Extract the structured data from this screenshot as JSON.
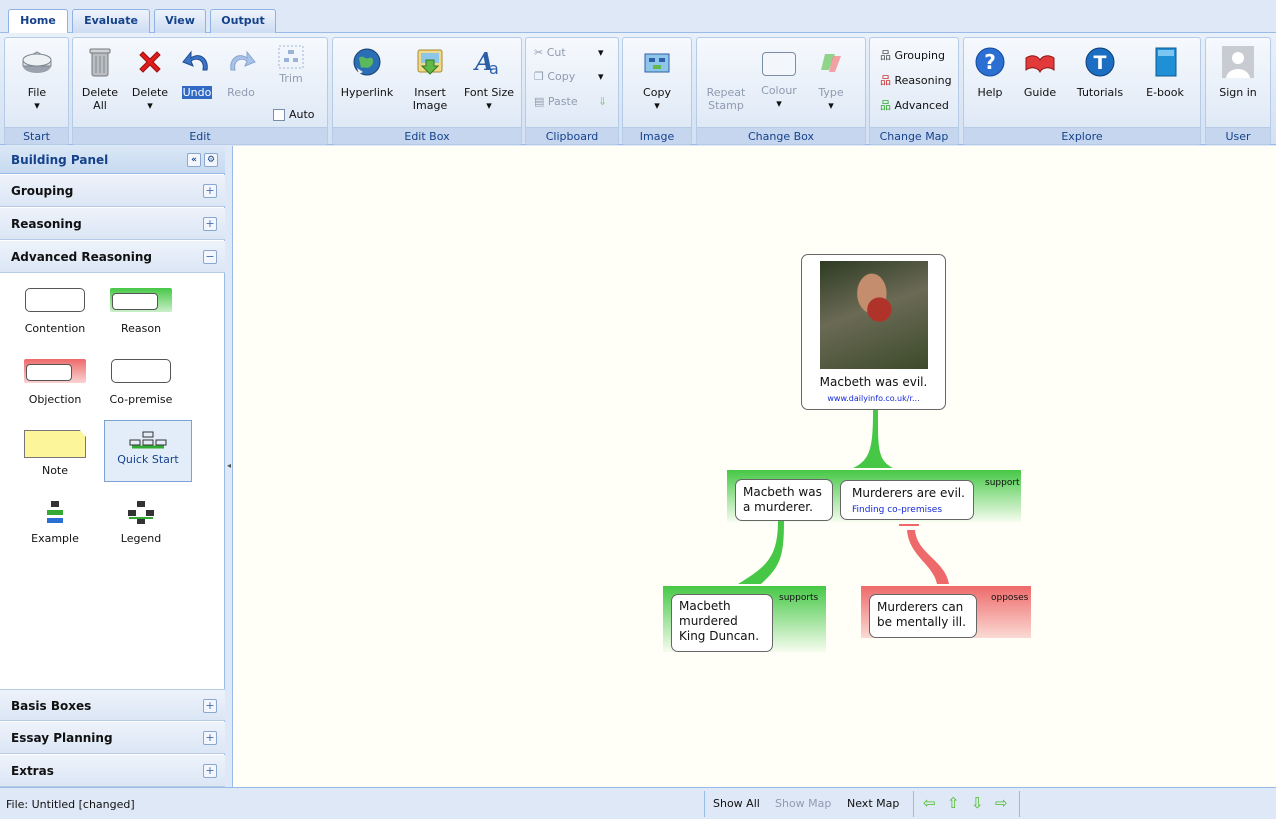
{
  "tabs": [
    "Home",
    "Evaluate",
    "View",
    "Output"
  ],
  "ribbon": {
    "start": {
      "title": "Start",
      "file": "File"
    },
    "edit": {
      "title": "Edit",
      "delete_all_1": "Delete",
      "delete_all_2": "All",
      "delete": "Delete",
      "undo": "Undo",
      "redo": "Redo",
      "trim": "Trim",
      "auto": "Auto"
    },
    "editbox": {
      "title": "Edit Box",
      "hyperlink": "Hyperlink",
      "insert_1": "Insert",
      "insert_2": "Image",
      "font_size": "Font Size"
    },
    "clipboard": {
      "title": "Clipboard",
      "cut": "Cut",
      "copy": "Copy",
      "paste": "Paste"
    },
    "image": {
      "title": "Image",
      "copy": "Copy"
    },
    "changebox": {
      "title": "Change Box",
      "repeat_1": "Repeat",
      "repeat_2": "Stamp",
      "colour": "Colour",
      "type": "Type"
    },
    "changemap": {
      "title": "Change Map",
      "grouping": "Grouping",
      "reasoning": "Reasoning",
      "advanced": "Advanced"
    },
    "explore": {
      "title": "Explore",
      "help": "Help",
      "guide": "Guide",
      "tutorials": "Tutorials",
      "ebook": "E-book"
    },
    "user": {
      "title": "User",
      "signin": "Sign in"
    }
  },
  "panel": {
    "title": "Building Panel",
    "sections_top": [
      "Grouping",
      "Reasoning",
      "Advanced Reasoning"
    ],
    "items": [
      "Contention",
      "Reason",
      "Objection",
      "Co-premise",
      "Note",
      "Quick Start",
      "Example",
      "Legend"
    ],
    "sections_bottom": [
      "Basis Boxes",
      "Essay Planning",
      "Extras"
    ]
  },
  "map": {
    "contention": "Macbeth was evil.",
    "contention_link": "www.dailyinfo.co.uk/r...",
    "premise1_a": "Macbeth was",
    "premise1_b": "a murderer.",
    "premise2": "Murderers are evil.",
    "premise2_link": "Finding co-premises",
    "support_label": "support",
    "reason_a": "Macbeth",
    "reason_b": "murdered",
    "reason_c": "King Duncan.",
    "supports_label": "supports",
    "objection_a": "Murderers can",
    "objection_b": "be mentally ill.",
    "opposes_label": "opposes"
  },
  "status": {
    "file": "File: Untitled [changed]",
    "show_all": "Show All",
    "show_map": "Show Map",
    "next_map": "Next Map"
  },
  "colors": {
    "support": "#46c846",
    "oppose": "#ee6a6a",
    "accent": "#15428b"
  }
}
